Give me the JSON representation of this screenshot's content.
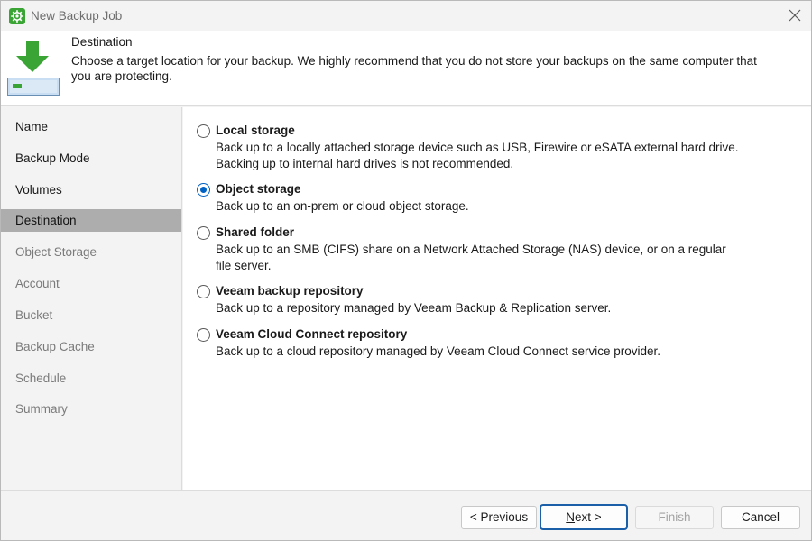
{
  "window": {
    "title": "New Backup Job"
  },
  "header": {
    "title": "Destination",
    "description": "Choose a target location for your backup. We highly recommend that you do not store your backups on the same computer that you are protecting."
  },
  "sidebar": {
    "items": [
      {
        "label": "Name",
        "state": "enabled"
      },
      {
        "label": "Backup Mode",
        "state": "enabled"
      },
      {
        "label": "Volumes",
        "state": "enabled"
      },
      {
        "label": "Destination",
        "state": "selected"
      },
      {
        "label": "Object Storage",
        "state": "disabled"
      },
      {
        "label": "Account",
        "state": "disabled"
      },
      {
        "label": "Bucket",
        "state": "disabled"
      },
      {
        "label": "Backup Cache",
        "state": "disabled"
      },
      {
        "label": "Schedule",
        "state": "disabled"
      },
      {
        "label": "Summary",
        "state": "disabled"
      }
    ]
  },
  "options": [
    {
      "title": "Local storage",
      "description": "Back up to a locally attached storage device such as USB, Firewire or eSATA external hard drive. Backing up to internal hard drives is not recommended.",
      "checked": false
    },
    {
      "title": "Object storage",
      "description": "Back up to an on-prem or cloud object storage.",
      "checked": true
    },
    {
      "title": "Shared folder",
      "description": "Back up to an SMB (CIFS) share on a Network Attached Storage (NAS) device, or on a regular file server.",
      "checked": false
    },
    {
      "title": "Veeam backup repository",
      "description": "Back up to a repository managed by Veeam Backup & Replication server.",
      "checked": false
    },
    {
      "title": "Veeam Cloud Connect repository",
      "description": "Back up to a cloud repository managed by Veeam Cloud Connect service provider.",
      "checked": false
    }
  ],
  "footer": {
    "previous_label": "< Previous",
    "next_label_first": "N",
    "next_label_rest": "ext >",
    "finish_label": "Finish",
    "cancel_label": "Cancel"
  },
  "colors": {
    "accent": "#0062c4",
    "brand_green": "#3aa534",
    "selected_nav": "#adadad"
  },
  "icons": {
    "app": "veeam-gear-icon",
    "close": "close-icon",
    "header": "download-to-drive-icon"
  }
}
